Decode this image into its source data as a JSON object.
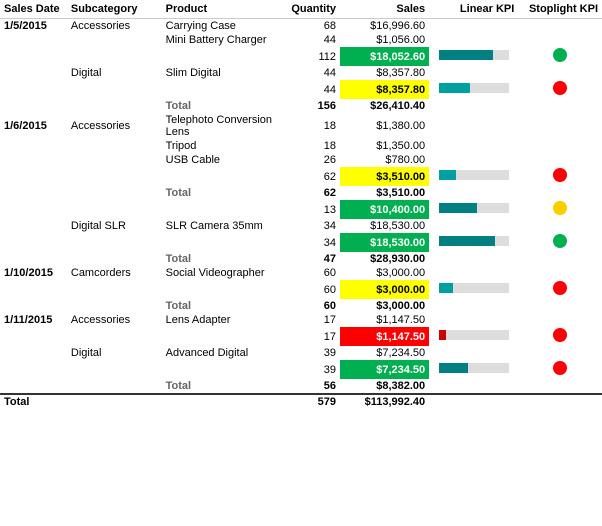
{
  "headers": {
    "sales_date": "Sales Date",
    "subcategory": "Subcategory",
    "product": "Product",
    "quantity": "Quantity",
    "sales": "Sales",
    "linear_kpi": "Linear KPI",
    "stoplight_kpi": "Stoplight KPI"
  },
  "colors": {
    "green": "#00b050",
    "yellow": "#ffff00",
    "red": "#ff0000",
    "stoplight_green": "#00b050",
    "stoplight_yellow": "#ffcc00",
    "stoplight_red": "#ff0000",
    "bar_bg": "#cccccc",
    "bar_teal": "#00b0a0",
    "bar_dark": "#006666"
  },
  "rows": [
    {
      "date": "1/5/2015",
      "subcategory": "Accessories",
      "product": "Carrying Case",
      "qty": 68,
      "sales": "$16,996.60",
      "highlight": null,
      "bar": 0,
      "stoplight": null
    },
    {
      "date": "",
      "subcategory": "",
      "product": "Mini Battery Charger",
      "qty": 44,
      "sales": "$1,056.00",
      "highlight": null,
      "bar": 0,
      "stoplight": null
    },
    {
      "date": "",
      "subcategory": "",
      "product": "",
      "qty": 112,
      "sales": "$18,052.60",
      "highlight": "green",
      "bar": 78,
      "stoplight": "green"
    },
    {
      "date": "",
      "subcategory": "Digital",
      "product": "Slim Digital",
      "qty": 44,
      "sales": "$8,357.80",
      "highlight": null,
      "bar": 0,
      "stoplight": null
    },
    {
      "date": "",
      "subcategory": "",
      "product": "",
      "qty": 44,
      "sales": "$8,357.80",
      "highlight": "yellow",
      "bar": 45,
      "stoplight": "red"
    },
    {
      "date": "",
      "subcategory": "Total",
      "product": "",
      "qty": 156,
      "sales": "$26,410.40",
      "highlight": null,
      "bar": 0,
      "stoplight": null
    },
    {
      "date": "1/6/2015",
      "subcategory": "Accessories",
      "product": "Telephoto Conversion Lens",
      "qty": 18,
      "sales": "$1,380.00",
      "highlight": null,
      "bar": 0,
      "stoplight": null
    },
    {
      "date": "",
      "subcategory": "",
      "product": "Tripod",
      "qty": 18,
      "sales": "$1,350.00",
      "highlight": null,
      "bar": 0,
      "stoplight": null
    },
    {
      "date": "",
      "subcategory": "",
      "product": "USB Cable",
      "qty": 26,
      "sales": "$780.00",
      "highlight": null,
      "bar": 0,
      "stoplight": null
    },
    {
      "date": "",
      "subcategory": "",
      "product": "",
      "qty": 62,
      "sales": "$3,510.00",
      "highlight": "yellow",
      "bar": 25,
      "stoplight": "red"
    },
    {
      "date": "",
      "subcategory": "Total",
      "product": "",
      "qty": 62,
      "sales": "$3,510.00",
      "highlight": null,
      "bar": 0,
      "stoplight": null
    },
    {
      "date": "",
      "subcategory": "",
      "product": "",
      "qty": 13,
      "sales": "$10,400.00",
      "highlight": "green",
      "bar": 55,
      "stoplight": "yellow"
    },
    {
      "date": "",
      "subcategory": "Digital SLR",
      "product": "SLR Camera 35mm",
      "qty": 34,
      "sales": "$18,530.00",
      "highlight": null,
      "bar": 0,
      "stoplight": null
    },
    {
      "date": "",
      "subcategory": "",
      "product": "",
      "qty": 34,
      "sales": "$18,530.00",
      "highlight": "green",
      "bar": 80,
      "stoplight": "green"
    },
    {
      "date": "",
      "subcategory": "Total",
      "product": "",
      "qty": 47,
      "sales": "$28,930.00",
      "highlight": null,
      "bar": 0,
      "stoplight": null
    },
    {
      "date": "1/10/2015",
      "subcategory": "Camcorders",
      "product": "Social Videographer",
      "qty": 60,
      "sales": "$3,000.00",
      "highlight": null,
      "bar": 0,
      "stoplight": null
    },
    {
      "date": "",
      "subcategory": "",
      "product": "",
      "qty": 60,
      "sales": "$3,000.00",
      "highlight": "yellow",
      "bar": 20,
      "stoplight": "red"
    },
    {
      "date": "",
      "subcategory": "Total",
      "product": "",
      "qty": 60,
      "sales": "$3,000.00",
      "highlight": null,
      "bar": 0,
      "stoplight": null
    },
    {
      "date": "1/11/2015",
      "subcategory": "Accessories",
      "product": "Lens Adapter",
      "qty": 17,
      "sales": "$1,147.50",
      "highlight": null,
      "bar": 0,
      "stoplight": null
    },
    {
      "date": "",
      "subcategory": "",
      "product": "",
      "qty": 17,
      "sales": "$1,147.50",
      "highlight": "red",
      "bar": 10,
      "stoplight": "red"
    },
    {
      "date": "",
      "subcategory": "Digital",
      "product": "Advanced Digital",
      "qty": 39,
      "sales": "$7,234.50",
      "highlight": null,
      "bar": 0,
      "stoplight": null
    },
    {
      "date": "",
      "subcategory": "",
      "product": "",
      "qty": 39,
      "sales": "$7,234.50",
      "highlight": "green",
      "bar": 42,
      "stoplight": "red"
    },
    {
      "date": "",
      "subcategory": "Total",
      "product": "",
      "qty": 56,
      "sales": "$8,382.00",
      "highlight": null,
      "bar": 0,
      "stoplight": null
    }
  ],
  "grand_total": {
    "label": "Total",
    "qty": 579,
    "sales": "$113,992.40"
  }
}
